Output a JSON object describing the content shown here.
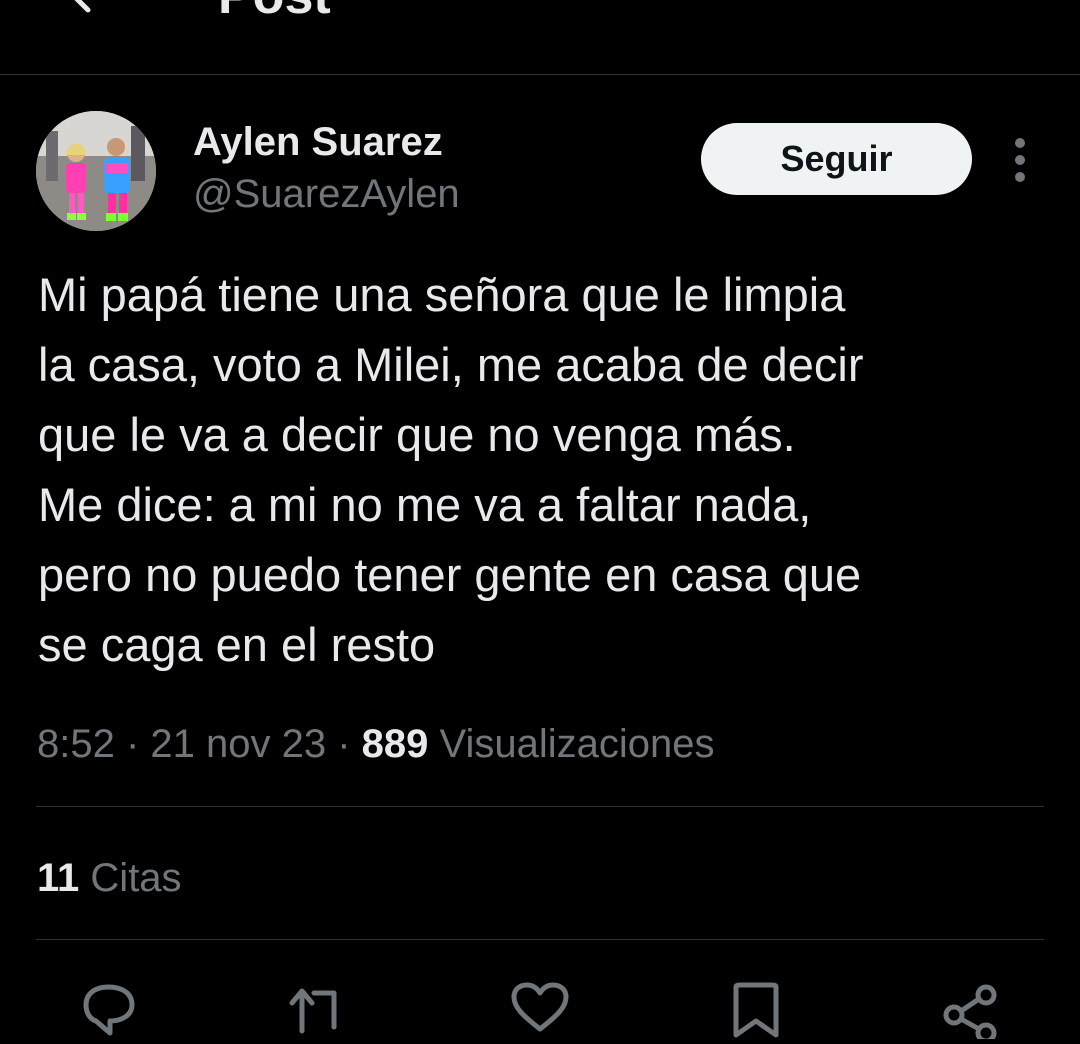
{
  "header": {
    "title": "Post",
    "back_icon": "arrow-left-icon"
  },
  "author": {
    "display_name": "Aylen Suarez",
    "handle": "@SuarezAylen",
    "avatar_icon": "user-avatar"
  },
  "follow_button": {
    "label": "Seguir"
  },
  "more_icon": "more-vertical-icon",
  "tweet": {
    "lines": [
      "Mi papá tiene una señora que le limpia",
      "la casa, voto a Milei, me acaba de decir",
      "que le va a decir que no venga más.",
      "Me dice: a mi no me va a faltar nada,",
      "pero no puedo tener gente en casa que",
      "se caga en el resto"
    ]
  },
  "meta": {
    "time": "8:52",
    "separator": " · ",
    "date": "21 nov 23",
    "views_count": "889",
    "views_label": "Visualizaciones"
  },
  "stats": {
    "quotes_count": "11",
    "quotes_label": "Citas"
  },
  "actions": [
    {
      "icon": "reply-icon"
    },
    {
      "icon": "repost-icon"
    },
    {
      "icon": "like-icon"
    },
    {
      "icon": "bookmark-icon"
    },
    {
      "icon": "share-icon"
    }
  ],
  "colors": {
    "background": "#000000",
    "text_primary": "#e7e9ea",
    "text_secondary": "#71767b",
    "divider": "#2f3336",
    "follow_bg": "#eff3f4",
    "follow_text": "#0f1419"
  }
}
